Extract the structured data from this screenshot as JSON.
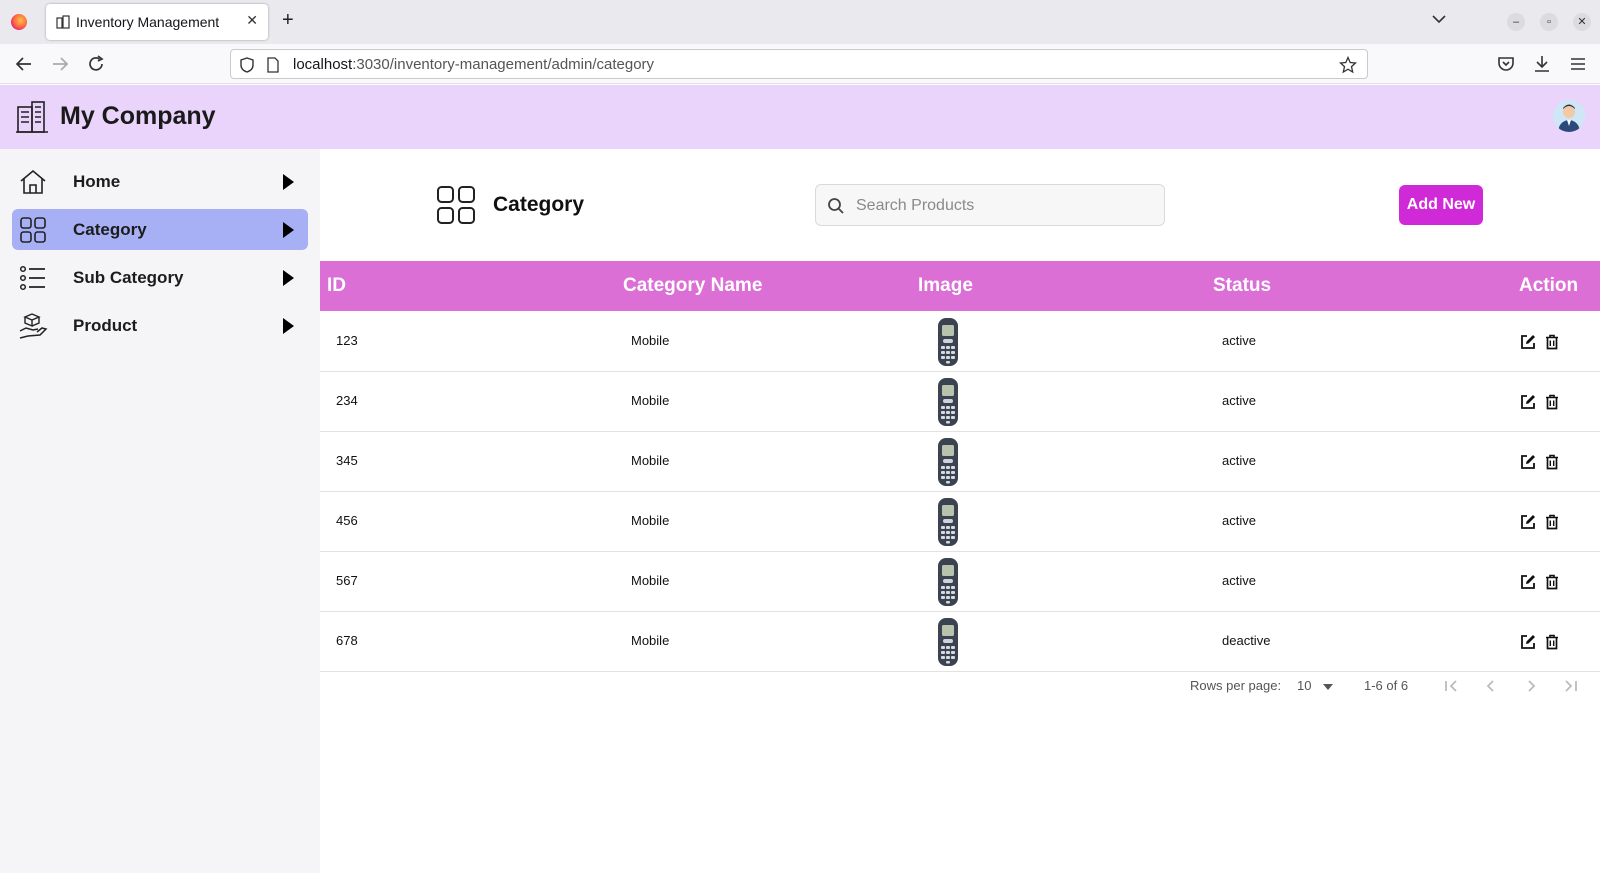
{
  "browser": {
    "tab_title": "Inventory Management",
    "url_host": "localhost",
    "url_path": ":3030/inventory-management/admin/category"
  },
  "header": {
    "brand": "My Company"
  },
  "sidebar": {
    "items": [
      {
        "label": "Home",
        "icon": "home-icon",
        "active": false
      },
      {
        "label": "Category",
        "icon": "grid-icon",
        "active": true
      },
      {
        "label": "Sub Category",
        "icon": "list-icon",
        "active": false
      },
      {
        "label": "Product",
        "icon": "hand-box-icon",
        "active": false
      }
    ]
  },
  "page": {
    "title": "Category",
    "search_placeholder": "Search Products",
    "add_button": "Add New"
  },
  "table": {
    "headers": [
      "ID",
      "Category Name",
      "Image",
      "Status",
      "Action"
    ],
    "rows": [
      {
        "id": "123",
        "name": "Mobile",
        "status": "active"
      },
      {
        "id": "234",
        "name": "Mobile",
        "status": "active"
      },
      {
        "id": "345",
        "name": "Mobile",
        "status": "active"
      },
      {
        "id": "456",
        "name": "Mobile",
        "status": "active"
      },
      {
        "id": "567",
        "name": "Mobile",
        "status": "active"
      },
      {
        "id": "678",
        "name": "Mobile",
        "status": "deactive"
      }
    ]
  },
  "pagination": {
    "rows_per_page_label": "Rows per page:",
    "rows_per_page": "10",
    "range": "1-6 of 6"
  },
  "colors": {
    "header_bg": "#ead4fb",
    "active_nav": "#a7b0f5",
    "table_header": "#dc6fd6",
    "add_button": "#d02ad8"
  }
}
